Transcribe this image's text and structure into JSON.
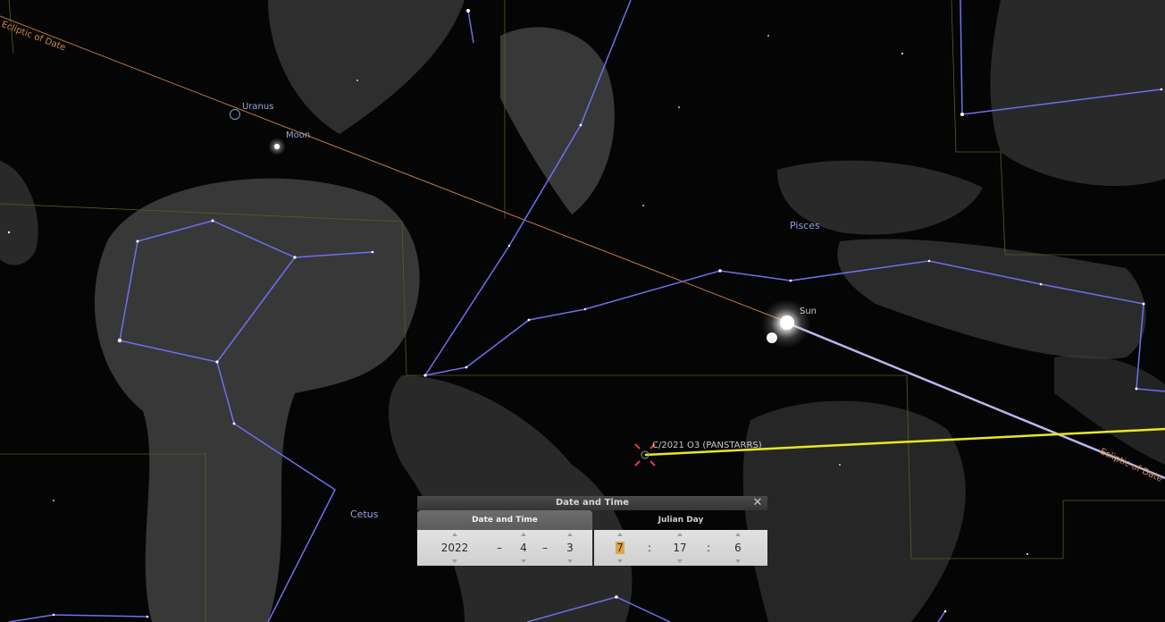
{
  "sky_labels": {
    "ecliptic_top": "Ecliptic of Date",
    "ecliptic_right": "Ecliptic of Date",
    "uranus": "Uranus",
    "moon": "Moon",
    "pisces": "Pisces",
    "sun": "Sun",
    "comet": "C/2021 O3 (PANSTARRS)",
    "cetus": "Cetus"
  },
  "colors": {
    "constellation_line": "#6f6ff0",
    "ecliptic_line": "#c07a3a",
    "comet_tail": "#e8e820",
    "boundary": "#5a5a2a",
    "sun_trail": "#b8b8f0",
    "comet_marker": "#e04040"
  },
  "dialog": {
    "title": "Date and Time",
    "close_icon": "close-icon",
    "tabs": [
      "Date and Time",
      "Julian Day"
    ],
    "date": {
      "year": "2022",
      "month": "4",
      "day": "3",
      "separator": "–"
    },
    "time": {
      "hour": "7",
      "minute": "17",
      "second": "6",
      "separator": ":"
    }
  }
}
